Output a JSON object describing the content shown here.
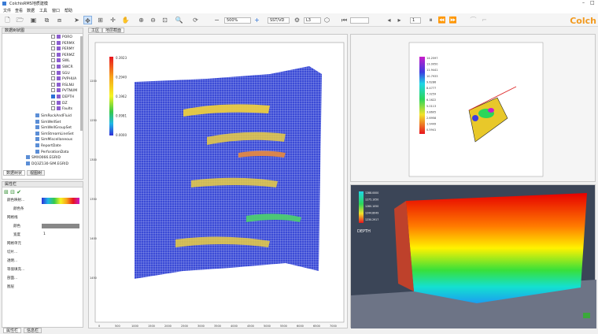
{
  "window": {
    "title": "ColchisRMS地质建模"
  },
  "menu": [
    "文件",
    "查看",
    "数据",
    "工具",
    "窗口",
    "帮助"
  ],
  "toolbar": {
    "zoom": "500%",
    "view": "SST/VD",
    "layer": "L3",
    "page": "1"
  },
  "brand": "Colch",
  "data_panel": {
    "title": "数据树状图",
    "items": [
      {
        "label": "PORO",
        "checked": false
      },
      {
        "label": "PERMX",
        "checked": false
      },
      {
        "label": "PERMY",
        "checked": false
      },
      {
        "label": "PERMZ",
        "checked": false
      },
      {
        "label": "SWL",
        "checked": false
      },
      {
        "label": "SWCR",
        "checked": false
      },
      {
        "label": "SGU",
        "checked": false
      },
      {
        "label": "PVPHUA",
        "checked": false
      },
      {
        "label": "RSLNU",
        "checked": false
      },
      {
        "label": "PVTNUM",
        "checked": false
      },
      {
        "label": "DEPTH",
        "checked": true
      },
      {
        "label": "DZ",
        "checked": false
      },
      {
        "label": "Faults",
        "checked": false
      }
    ],
    "groups": [
      "SimRockAndFluid",
      "SimWellSet",
      "SimWellGroupSet",
      "SimStreamLineSet",
      "SimMiscellaneous",
      "ReportDate",
      "PerforationData",
      "SMX0066.EGRID",
      "DQ3Z130-SIM.EGRID"
    ],
    "tabs": [
      "数据树状",
      "视图树"
    ]
  },
  "prop_panel": {
    "title": "属性栏",
    "rows": [
      "颜色映射...",
      "颜色条",
      "网格线",
      "颜色",
      "宽度",
      "网格单元",
      "切片...",
      "透明...",
      "等值填充...",
      "剖面...",
      "图层"
    ],
    "width_value": "1",
    "tabs": [
      "属性栏",
      "信息栏"
    ]
  },
  "doc_tabs": [
    "工区",
    "地层截面"
  ],
  "section": {
    "colorbar": [
      "0.3923",
      "0.2940",
      "0.1962",
      "0.0981",
      "0.0000"
    ],
    "x_ticks": [
      "0",
      "500",
      "1000",
      "1500",
      "2000",
      "2500",
      "3000",
      "3500",
      "4000",
      "4500",
      "5000",
      "5500",
      "6000",
      "6500",
      "7000"
    ],
    "y_ticks": [
      "1200",
      "1250",
      "1300",
      "1350",
      "1400",
      "1450"
    ]
  },
  "map": {
    "colorbar": [
      "14.2597",
      "13.0950",
      "11.9441",
      "10.7933",
      "9.6286",
      "8.4777",
      "7.3259",
      "6.1622",
      "5.0113",
      "3.8605",
      "2.6958",
      "1.9449",
      "0.5941"
    ]
  },
  "view3d": {
    "legend": [
      "1288.0000",
      "1275.1050",
      "1260.1050",
      "1244.8049",
      "1230.2917"
    ],
    "label": "DEPTH"
  }
}
